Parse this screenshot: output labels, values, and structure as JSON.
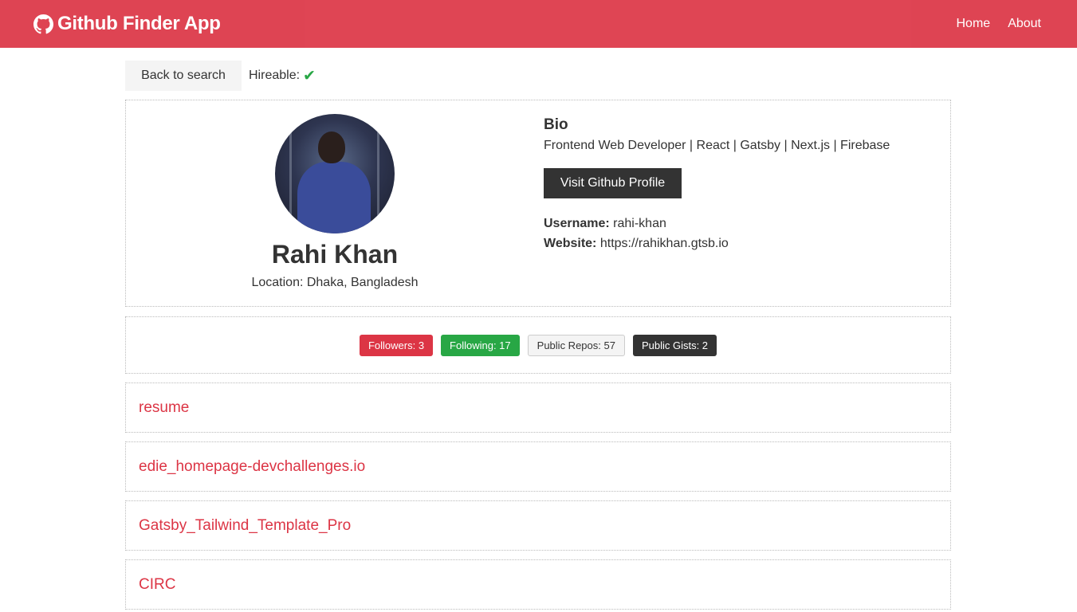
{
  "navbar": {
    "brand": "Github Finder App",
    "links": [
      "Home",
      "About"
    ]
  },
  "topbar": {
    "back_label": "Back to search",
    "hireable_label": "Hireable:"
  },
  "profile": {
    "name": "Rahi Khan",
    "location": "Location: Dhaka, Bangladesh",
    "bio_title": "Bio",
    "bio": "Frontend Web Developer | React | Gatsby | Next.js | Firebase",
    "visit_label": "Visit Github Profile",
    "username_label": "Username:",
    "username": "rahi-khan",
    "website_label": "Website:",
    "website": "https://rahikhan.gtsb.io"
  },
  "stats": {
    "followers": "Followers: 3",
    "following": "Following: 17",
    "repos": "Public Repos: 57",
    "gists": "Public Gists: 2"
  },
  "repos": [
    "resume",
    "edie_homepage-devchallenges.io",
    "Gatsby_Tailwind_Template_Pro",
    "CIRC"
  ],
  "colors": {
    "primary": "#dc3545",
    "success": "#28a745",
    "dark": "#333333",
    "light": "#f4f4f4"
  }
}
